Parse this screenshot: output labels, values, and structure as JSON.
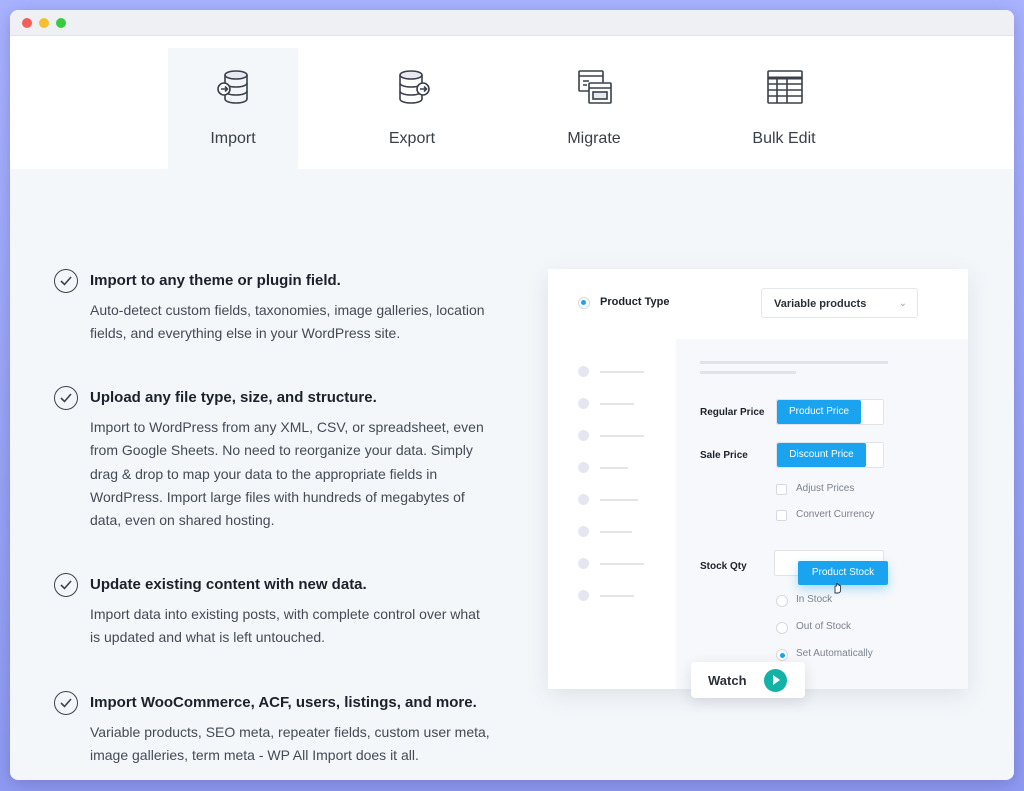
{
  "tabs": [
    {
      "label": "Import",
      "icon": "database-import-icon",
      "active": true
    },
    {
      "label": "Export",
      "icon": "database-export-icon",
      "active": false
    },
    {
      "label": "Migrate",
      "icon": "migrate-windows-icon",
      "active": false
    },
    {
      "label": "Bulk Edit",
      "icon": "spreadsheet-icon",
      "active": false
    }
  ],
  "features": [
    {
      "title": "Import to any theme or plugin field.",
      "body": "Auto-detect custom fields, taxonomies, image galleries, location fields, and everything else in your WordPress site."
    },
    {
      "title": "Upload any file type, size, and structure.",
      "body": "Import to WordPress from any XML, CSV, or spreadsheet, even from Google Sheets. No need to reorganize your data. Simply drag & drop to map your data to the appropriate fields in WordPress. Import large files with hundreds of megabytes of data, even on shared hosting."
    },
    {
      "title": "Update existing content with new data.",
      "body": "Import data into existing posts, with complete control over what is updated and what is left untouched."
    },
    {
      "title": "Import WooCommerce, ACF, users, listings, and more.",
      "body": "Variable products, SEO meta, repeater fields, custom user meta, image galleries, term meta - WP All Import does it all."
    }
  ],
  "mockup": {
    "product_type_label": "Product Type",
    "product_type_value": "Variable products",
    "regular_price_label": "Regular Price",
    "regular_price_pill": "Product Price",
    "sale_price_label": "Sale Price",
    "sale_price_pill": "Discount Price",
    "checkbox_adjust": "Adjust Prices",
    "checkbox_convert": "Convert Currency",
    "stock_qty_label": "Stock Qty",
    "stock_pill": "Product Stock",
    "radio_in_stock": "In Stock",
    "radio_out_of_stock": "Out of Stock",
    "radio_set_auto": "Set Automatically",
    "selected_stock_option": "Set Automatically"
  },
  "watch": {
    "label": "Watch",
    "icon": "play-icon"
  },
  "colors": {
    "accent": "#1aa3ef",
    "play": "#12b3a6",
    "background": "#f4f7fa"
  }
}
